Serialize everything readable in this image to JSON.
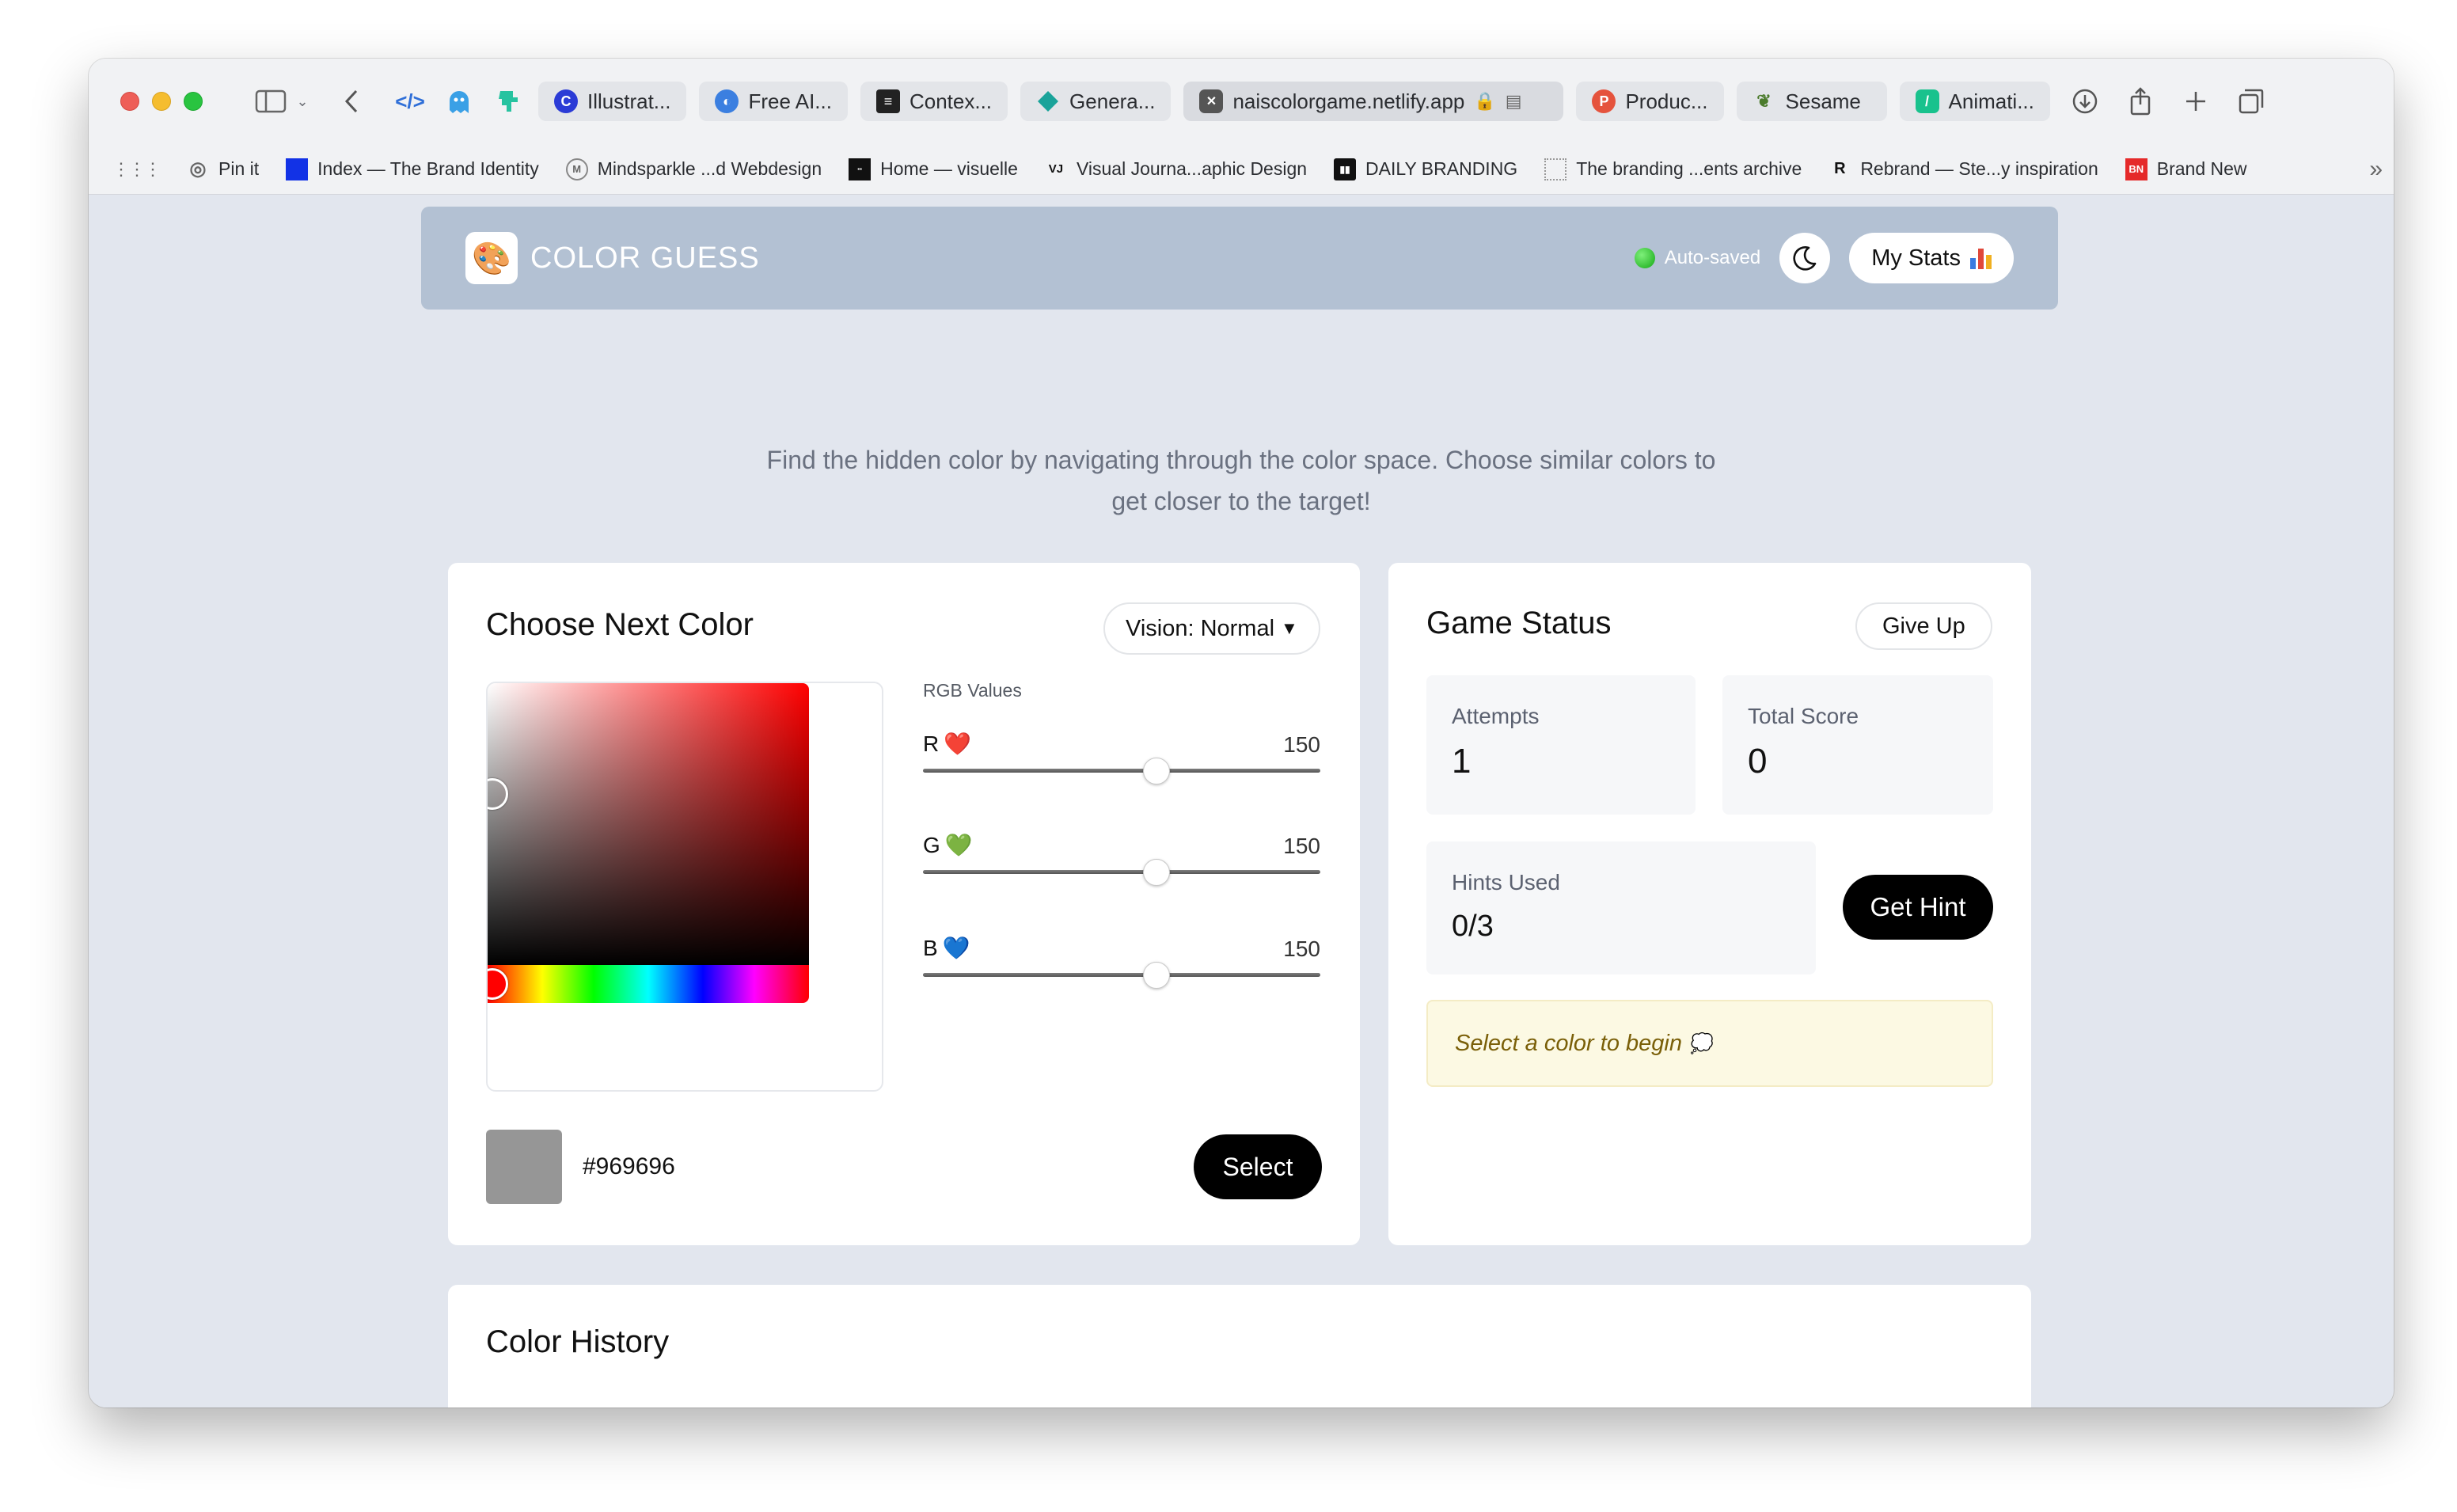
{
  "browser": {
    "tabs": [
      {
        "label": "Illustrat...",
        "icon": "c-logo-icon"
      },
      {
        "label": "Free AI...",
        "icon": "ai-swirl-icon"
      },
      {
        "label": "Contex...",
        "icon": "context-logo-icon"
      },
      {
        "label": "Genera...",
        "icon": "diamond-icon"
      },
      {
        "label": "naiscolorgame.netlify.app",
        "icon": "close-icon"
      },
      {
        "label": "Produc...",
        "icon": "producthunt-icon"
      },
      {
        "label": "Sesame",
        "icon": "leaf-icon"
      },
      {
        "label": "Animati...",
        "icon": "animation-icon"
      }
    ],
    "bookmarks": [
      {
        "label": "Pin it",
        "icon": "globe-icon"
      },
      {
        "label": "Index — The Brand Identity",
        "icon": "blue-square-icon"
      },
      {
        "label": "Mindsparkle ...d Webdesign",
        "icon": "mindsparkle-icon"
      },
      {
        "label": "Home — visuelle",
        "icon": "visuelle-icon"
      },
      {
        "label": "Visual Journa...aphic Design",
        "icon": "vj-icon",
        "mark": "VJ"
      },
      {
        "label": "DAILY BRANDING",
        "icon": "db-icon"
      },
      {
        "label": "The branding ...ents archive",
        "icon": "dotted-square-icon"
      },
      {
        "label": "Rebrand — Ste...y inspiration",
        "icon": "rebrand-icon",
        "mark": "R"
      },
      {
        "label": "Brand New",
        "icon": "bn-icon",
        "mark": "BN"
      }
    ]
  },
  "header": {
    "title": "COLOR GUESS",
    "autosave": "Auto-saved",
    "stats_label": "My Stats"
  },
  "intro": {
    "line1": "Find the hidden color by navigating through the color space. Choose similar colors to",
    "line2": "get closer to the target!"
  },
  "choose": {
    "title": "Choose Next Color",
    "vision_label": "Vision: Normal",
    "rgb_title": "RGB Values",
    "sliders": [
      {
        "label": "R",
        "emoji": "❤️",
        "value": "150",
        "fraction": 0.588
      },
      {
        "label": "G",
        "emoji": "💚",
        "value": "150",
        "fraction": 0.588
      },
      {
        "label": "B",
        "emoji": "💙",
        "value": "150",
        "fraction": 0.588
      }
    ],
    "hex": "#969696",
    "swatch_color": "#969696",
    "select_label": "Select"
  },
  "status": {
    "title": "Game Status",
    "giveup_label": "Give Up",
    "attempts_label": "Attempts",
    "attempts_value": "1",
    "score_label": "Total Score",
    "score_value": "0",
    "hints_label": "Hints Used",
    "hints_value": "0/3",
    "hint_button": "Get Hint",
    "message": "Select a color to begin",
    "message_emoji": "💭"
  },
  "history": {
    "title": "Color History"
  }
}
